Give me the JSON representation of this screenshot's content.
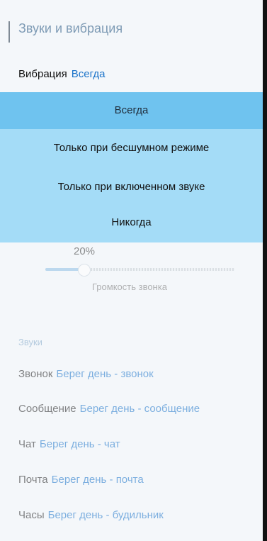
{
  "header": {
    "title": "Звуки и вибрация"
  },
  "vibration": {
    "label": "Вибрация",
    "value": "Всегда"
  },
  "dropdown": {
    "selected": "Всегда",
    "options": [
      "Всегда",
      "Только при бесшумном режиме",
      "Только при включенном звуке",
      "Никогда"
    ]
  },
  "volume": {
    "percent_text": "20%",
    "level": 0.2,
    "label": "Громкость звонка"
  },
  "sounds": {
    "section_title": "Звуки",
    "items": [
      {
        "label": "Звонок",
        "value": "Берег день - звонок"
      },
      {
        "label": "Сообщение",
        "value": "Берег день - сообщение"
      },
      {
        "label": "Чат",
        "value": "Берег день - чат"
      },
      {
        "label": "Почта",
        "value": "Берег день - почта"
      },
      {
        "label": "Часы",
        "value": "Берег день - будильник"
      }
    ]
  },
  "colors": {
    "accent_blue": "#1a73c9",
    "dropdown_bg": "#a4dcf7",
    "dropdown_selected_bg": "#6fc3ef"
  }
}
